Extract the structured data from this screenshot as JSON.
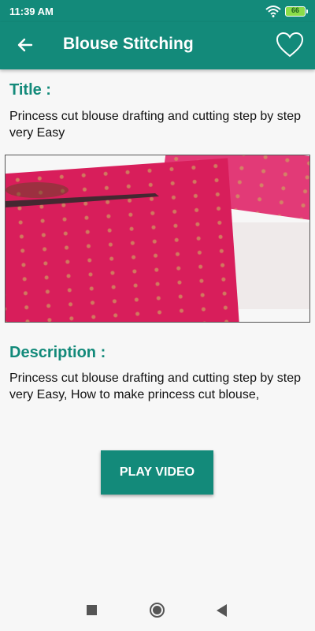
{
  "status_bar": {
    "time": "11:39 AM",
    "battery": "66"
  },
  "app_bar": {
    "title": "Blouse Stitching"
  },
  "content": {
    "title_heading": "Title :",
    "title_text": "Princess cut blouse drafting and cutting step by step very Easy",
    "description_heading": "Description :",
    "description_text": "Princess cut blouse drafting and cutting step by step very Easy, How to make princess cut blouse,"
  },
  "play_button": {
    "label": "PLAY VIDEO"
  },
  "icons": {
    "back": "back-arrow-icon",
    "favorite": "heart-outline-icon",
    "wifi": "wifi-icon",
    "battery": "battery-icon"
  },
  "colors": {
    "primary": "#138a7a",
    "fabric": "#d81e5b"
  }
}
